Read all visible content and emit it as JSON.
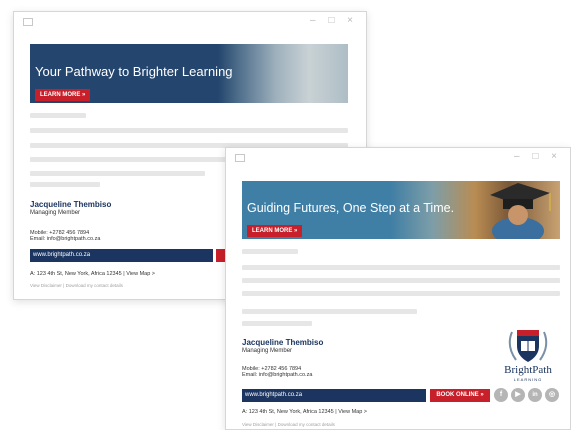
{
  "signature_one": {
    "banner": {
      "headline": "Your Pathway to Brighter Learning",
      "cta": "LEARN MORE »"
    },
    "name": "Jacqueline Thembiso",
    "title": "Managing Member",
    "mobile": "Mobile: +2782 456 7894",
    "email": "Email: info@brightpath.co.za",
    "website": "www.brightpath.co.za",
    "address": "A: 123 4th St, New York, Africa 12345",
    "map_link": "View Map >",
    "disclaimer_link": "View Disclaimer",
    "download_link": "Download my contact details",
    "separator": "|"
  },
  "signature_two": {
    "banner": {
      "headline": "Guiding Futures, One Step at a Time.",
      "cta": "LEARN MORE »"
    },
    "name": "Jacqueline Thembiso",
    "title": "Managing Member",
    "mobile": "Mobile: +2782 456 7894",
    "email": "Email: info@brightpath.co.za",
    "website": "www.brightpath.co.za",
    "book_button": "BOOK ONLINE »",
    "address": "A: 123 4th St, New York, Africa 12345",
    "map_link": "View Map >",
    "disclaimer_link": "View Disclaimer",
    "download_link": "Download my contact details",
    "separator": "|",
    "logo": {
      "name": "BrightPath",
      "sub": "LEARNING"
    },
    "social": [
      {
        "icon": "facebook-icon",
        "glyph": "f"
      },
      {
        "icon": "youtube-icon",
        "glyph": "▶"
      },
      {
        "icon": "linkedin-icon",
        "glyph": "in"
      },
      {
        "icon": "instagram-icon",
        "glyph": "◎"
      }
    ]
  },
  "window_controls": {
    "minimize": "–",
    "maximize": "□",
    "close": "×"
  },
  "colors": {
    "navy": "#1b3560",
    "red": "#c8202a",
    "placeholder": "#e6e6e6",
    "banner_two": "#3f7ea5"
  }
}
